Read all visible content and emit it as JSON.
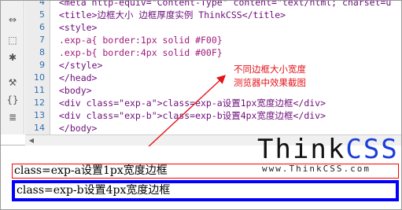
{
  "toolbar": {
    "icons": [
      "split-icon",
      "select-icon",
      "gear-icon",
      "wrench-icon",
      "braces-icon",
      "list-icon"
    ]
  },
  "editor": {
    "line_numbers": [
      "4",
      "5",
      "6",
      "7",
      "8",
      "9",
      "10",
      "11",
      "12",
      "13",
      "14"
    ],
    "lines": [
      "<meta http-equiv=\"Content-Type\" content=\"text/html; charset=u",
      "<title>边框大小 边框厚度实例 ThinkCSS</title>",
      "<style>",
      ".exp-a{ border:1px solid #F00}",
      ".exp-b{ border:4px solid #00F}",
      "</style>",
      "</head>",
      "<body>",
      "<div class=\"exp-a\">class=exp-a设置1px宽度边框</div>",
      "<div class=\"exp-b\">class=exp-b设置4px宽度边框</div>",
      "</body>"
    ]
  },
  "annotation": {
    "line1": "不同边框大小宽度",
    "line2": "测览器中效果截图",
    "color": "#e4141b"
  },
  "logo": {
    "think": "Think",
    "css": "CSS",
    "url": "www.ThinkCSS.com"
  },
  "preview": {
    "box_a": "class=exp-a设置1px宽度边框",
    "box_b": "class=exp-b设置4px宽度边框",
    "box_a_border_color": "#FF0000",
    "box_b_border_color": "#0000FF"
  }
}
